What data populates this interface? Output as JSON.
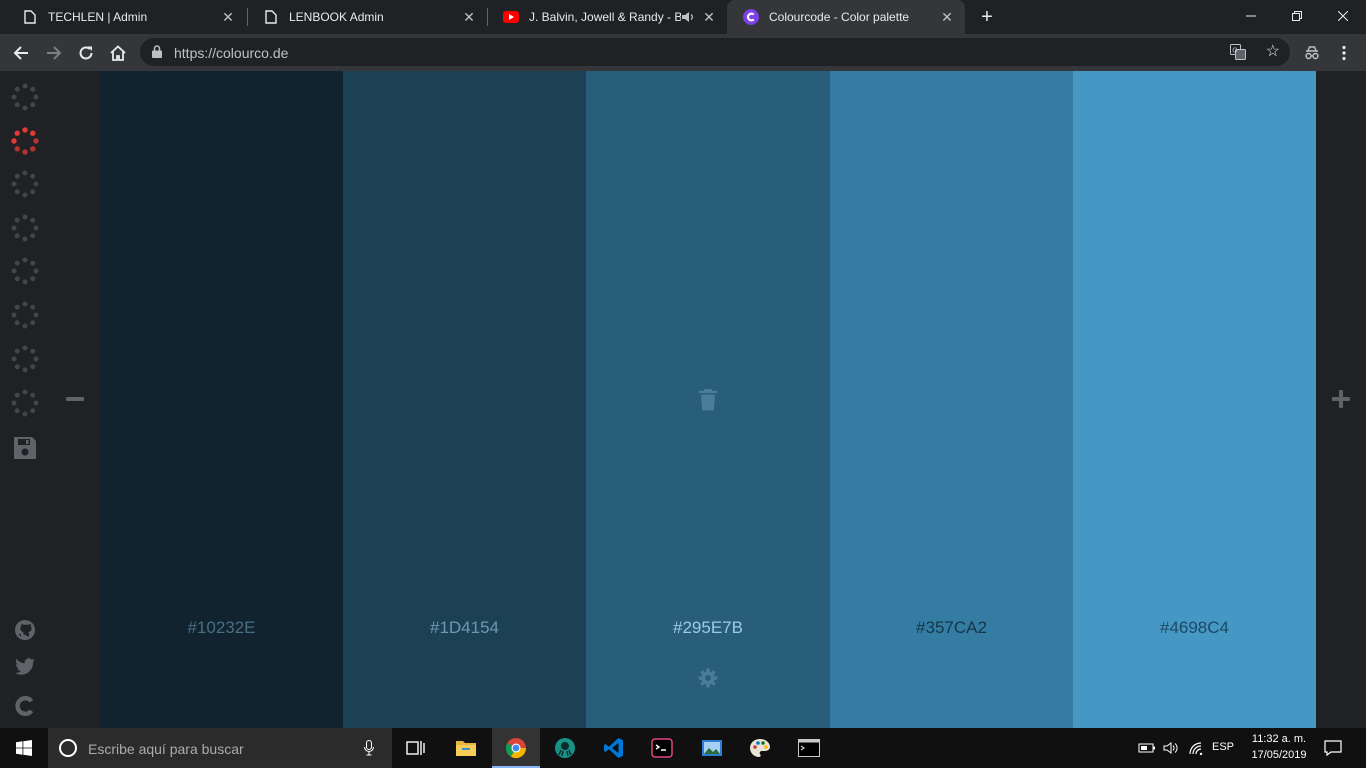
{
  "browser": {
    "tabs": [
      {
        "title": "TECHLEN | Admin",
        "favicon": "page-icon",
        "active": false
      },
      {
        "title": "LENBOOK Admin",
        "favicon": "page-icon",
        "active": false
      },
      {
        "title": "J. Balvin, Jowell & Randy - Bo",
        "favicon": "youtube-icon",
        "active": false,
        "audio": true
      },
      {
        "title": "Colourcode - Color palette",
        "favicon": "colourcode-icon",
        "active": true
      }
    ],
    "url": "https://colourco.de"
  },
  "sidebar": {
    "palette_modes": 8,
    "active_mode_color": "#e53935",
    "inactive_mode_color": "#444547"
  },
  "palette": {
    "colors": [
      {
        "hex": "#10232E",
        "text_color": "#4a6f85"
      },
      {
        "hex": "#1D4154",
        "text_color": "#6c98b1"
      },
      {
        "hex": "#295E7B",
        "text_color": "#9ccbe6"
      },
      {
        "hex": "#357CA2",
        "text_color": "#13364a"
      },
      {
        "hex": "#4698C4",
        "text_color": "#1c4966"
      }
    ],
    "hovered_index": 2
  },
  "taskbar": {
    "search_placeholder": "Escribe aquí para buscar",
    "language": "ESP",
    "time": "11:32 a. m.",
    "date": "17/05/2019"
  }
}
